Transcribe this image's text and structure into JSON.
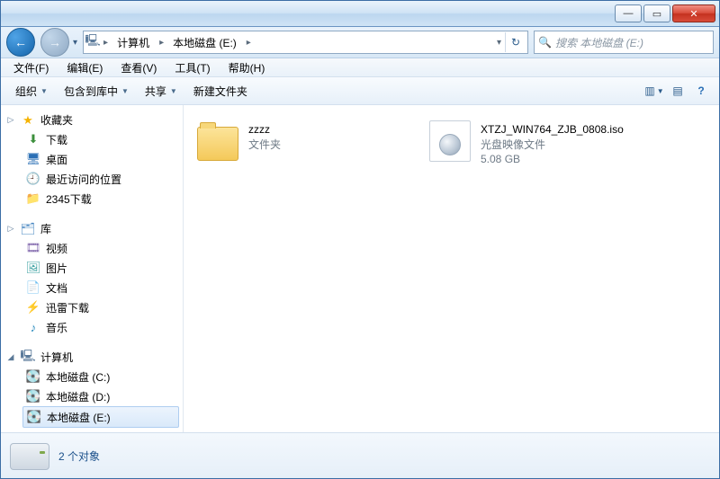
{
  "titlebar": {
    "min": "—",
    "max": "▭",
    "close": "✕"
  },
  "nav": {
    "segments": [
      "计算机",
      "本地磁盘 (E:)"
    ],
    "history_chevron": "▾",
    "back_glyph": "←",
    "fwd_glyph": "→",
    "refresh_glyph": "↻"
  },
  "search": {
    "placeholder": "搜索 本地磁盘 (E:)",
    "icon": "🔍"
  },
  "menubar": [
    "文件(F)",
    "编辑(E)",
    "查看(V)",
    "工具(T)",
    "帮助(H)"
  ],
  "toolbar": {
    "organize": "组织",
    "include": "包含到库中",
    "share": "共享",
    "newfolder": "新建文件夹",
    "dd": "▼",
    "view_icon": "▥",
    "preview_icon": "▤",
    "help_icon": "?"
  },
  "sidebar": {
    "favorites": {
      "label": "收藏夹",
      "items": [
        {
          "icon": "dl",
          "glyph": "⬇",
          "label": "下载"
        },
        {
          "icon": "desk",
          "glyph": "🖥",
          "label": "桌面"
        },
        {
          "icon": "recent",
          "glyph": "🕘",
          "label": "最近访问的位置"
        },
        {
          "icon": "folder",
          "glyph": "📁",
          "label": "2345下载"
        }
      ]
    },
    "libraries": {
      "label": "库",
      "items": [
        {
          "icon": "vid",
          "glyph": "🎞",
          "label": "视频"
        },
        {
          "icon": "pic",
          "glyph": "🖼",
          "label": "图片"
        },
        {
          "icon": "doc",
          "glyph": "📄",
          "label": "文档"
        },
        {
          "icon": "thdl",
          "glyph": "⚡",
          "label": "迅雷下载"
        },
        {
          "icon": "mus",
          "glyph": "♪",
          "label": "音乐"
        }
      ]
    },
    "computer": {
      "label": "计算机",
      "items": [
        {
          "icon": "drive",
          "glyph": "💽",
          "label": "本地磁盘 (C:)",
          "selected": false
        },
        {
          "icon": "drive",
          "glyph": "💽",
          "label": "本地磁盘 (D:)",
          "selected": false
        },
        {
          "icon": "drive",
          "glyph": "💽",
          "label": "本地磁盘 (E:)",
          "selected": true
        }
      ]
    }
  },
  "content": {
    "items": [
      {
        "kind": "folder",
        "name": "zzzz",
        "sub1": "文件夹",
        "sub2": ""
      },
      {
        "kind": "iso",
        "name": "XTZJ_WIN764_ZJB_0808.iso",
        "sub1": "光盘映像文件",
        "sub2": "5.08 GB"
      }
    ]
  },
  "details": {
    "text": "2 个对象"
  }
}
